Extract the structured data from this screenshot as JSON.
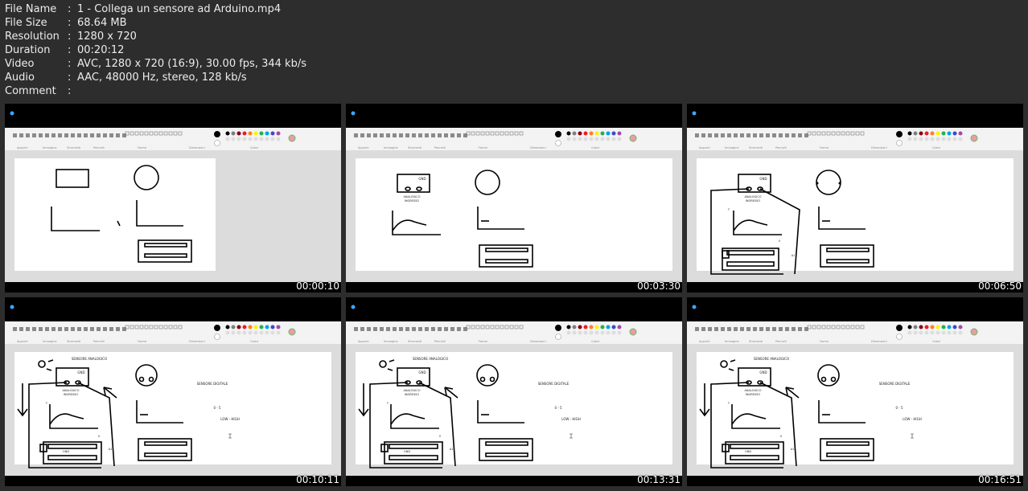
{
  "info": [
    {
      "label": "File Name",
      "value": "1 - Collega un sensore ad Arduino.mp4"
    },
    {
      "label": "File Size",
      "value": "68.64 MB"
    },
    {
      "label": "Resolution",
      "value": "1280 x 720"
    },
    {
      "label": "Duration",
      "value": "00:20:12"
    },
    {
      "label": "Video",
      "value": "AVC, 1280 x 720 (16:9), 30.00 fps, 344 kb/s"
    },
    {
      "label": "Audio",
      "value": "AAC, 48000 Hz, stereo, 128 kb/s"
    },
    {
      "label": "Comment",
      "value": ""
    }
  ],
  "separator": ":",
  "ribbon_groups": [
    "Appunti",
    "Immagine",
    "Strumenti",
    "Pennelli",
    "Forme",
    "Dimensioni",
    "Colori"
  ],
  "thumbs": [
    {
      "time": "00:00:10",
      "stage": 1,
      "texts": []
    },
    {
      "time": "00:03:30",
      "stage": 2,
      "texts": [
        "GND",
        "ANALOGICO",
        "INGRESSO"
      ]
    },
    {
      "time": "00:06:50",
      "stage": 3,
      "texts": [
        "GND",
        "ANALOGICO",
        "INGRESSO",
        "T",
        "V",
        "A1"
      ]
    },
    {
      "time": "00:10:11",
      "stage": 4,
      "texts": [
        "SENSORE ANALOGICO",
        "GND",
        "ANALOGICO",
        "INGRESSO",
        "T",
        "V",
        "GND",
        "A1",
        "SENSORE DIGITALE",
        "0 - 5",
        "LOW - HIGH"
      ]
    },
    {
      "time": "00:13:31",
      "stage": 4,
      "texts": [
        "SENSORE ANALOGICO",
        "GND",
        "ANALOGICO",
        "INGRESSO",
        "T",
        "V",
        "GND",
        "A1",
        "SENSORE DIGITALE",
        "0 - 5",
        "LOW - HIGH"
      ]
    },
    {
      "time": "00:16:51",
      "stage": 4,
      "texts": [
        "SENSORE ANALOGICO",
        "GND",
        "ANALOGICO",
        "INGRESSO",
        "T",
        "V",
        "GND",
        "A1",
        "SENSORE DIGITALE",
        "0 - 5",
        "LOW - HIGH"
      ]
    }
  ],
  "palette": [
    "#000000",
    "#7f7f7f",
    "#880015",
    "#ed1c24",
    "#ff7f27",
    "#fff200",
    "#22b14c",
    "#00a2e8",
    "#3f48cc",
    "#a349a4"
  ]
}
